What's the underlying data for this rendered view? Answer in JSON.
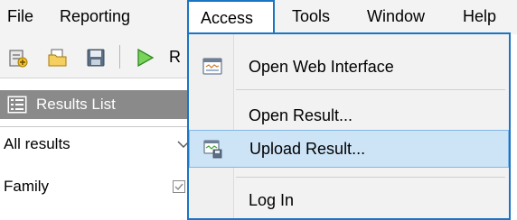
{
  "menubar": {
    "file": "File",
    "reporting": "Reporting",
    "access": "Access",
    "tools": "Tools",
    "window": "Window",
    "help": "Help"
  },
  "toolbar": {
    "run_label": "R",
    "icons": [
      "new-report-icon",
      "open-folder-icon",
      "save-icon",
      "run-icon"
    ]
  },
  "results_panel": {
    "title": "Results List",
    "filter_value": "All results",
    "column_label": "Family"
  },
  "access_menu": {
    "items": [
      {
        "label": "Open Web Interface",
        "icon": "web-interface-icon"
      },
      {
        "label": "Open Result...",
        "icon": ""
      },
      {
        "label": "Upload Result...",
        "icon": "upload-result-icon",
        "highlighted": true
      },
      {
        "label": "Log In",
        "icon": ""
      }
    ]
  },
  "colors": {
    "accent": "#1b74c4",
    "highlight": "#cde4f7",
    "panel_title": "#8a8a8a"
  }
}
